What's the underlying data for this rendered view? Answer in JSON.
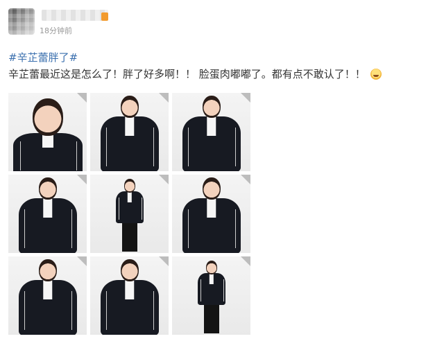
{
  "post": {
    "time": "18分钟前",
    "hashtag": "#辛芷蕾胖了#",
    "text": "辛芷蕾最近这是怎么了！胖了好多啊！！ 脸蛋肉嘟嘟了。都有点不敢认了！！"
  },
  "icons": {
    "avatar": "avatar-pixelated",
    "emoji": "laugh-cry-emoji"
  },
  "colors": {
    "hashtag": "#3a6fae",
    "text": "#333333",
    "time": "#999999"
  },
  "photos": [
    {
      "shot": "closeup"
    },
    {
      "shot": "half"
    },
    {
      "shot": "half"
    },
    {
      "shot": "half"
    },
    {
      "shot": "full"
    },
    {
      "shot": "half"
    },
    {
      "shot": "half"
    },
    {
      "shot": "half"
    },
    {
      "shot": "full"
    }
  ]
}
